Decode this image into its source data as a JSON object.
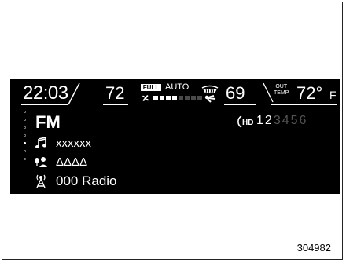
{
  "climate": {
    "clock": "22:03",
    "driver_temp": "72",
    "full_badge": "FULL",
    "auto_label": "AUTO",
    "fan_level": 4,
    "fan_max": 8,
    "passenger_temp": "69",
    "out_label_line1": "OUT",
    "out_label_line2": "TEMP",
    "outside_temp": "72°",
    "outside_unit": "F"
  },
  "audio": {
    "band": "FM",
    "hd_presets": [
      "1",
      "2",
      "3",
      "4",
      "5",
      "6"
    ],
    "hd_active_count": 2,
    "song": "xxxxxx",
    "artist": "ΔΔΔΔ",
    "station": "000 Radio"
  },
  "figure_code": "304982",
  "colors": {
    "display_bg": "#000000",
    "text": "#ffffff",
    "inactive": "#555555"
  }
}
